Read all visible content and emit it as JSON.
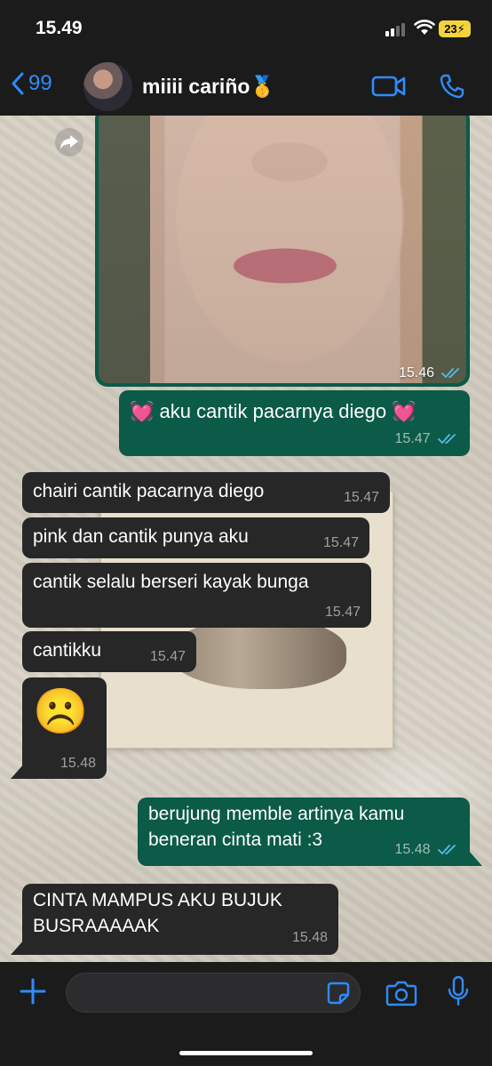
{
  "status_bar": {
    "time": "15.49",
    "battery": "23"
  },
  "header": {
    "back_count": "99",
    "contact_name": "miiii cariño🥇"
  },
  "messages": [
    {
      "id": "photo",
      "direction": "out",
      "type": "image",
      "time": "15.46"
    },
    {
      "id": "m1",
      "direction": "out",
      "text": "💓 aku cantik pacarnya diego 💓",
      "time": "15.47"
    },
    {
      "id": "m2",
      "direction": "in",
      "text": "chairi cantik pacarnya diego",
      "time": "15.47"
    },
    {
      "id": "m3",
      "direction": "in",
      "text": "pink dan cantik punya aku",
      "time": "15.47"
    },
    {
      "id": "m4",
      "direction": "in",
      "text": "cantik selalu berseri kayak bunga",
      "time": "15.47"
    },
    {
      "id": "m5",
      "direction": "in",
      "text": "cantikku",
      "time": "15.47"
    },
    {
      "id": "m6",
      "direction": "in",
      "text": "☹️",
      "time": "15.48"
    },
    {
      "id": "m7",
      "direction": "out",
      "text": "berujung memble artinya kamu beneran cinta mati :3",
      "time": "15.48"
    },
    {
      "id": "m8",
      "direction": "in",
      "text": "CINTA MAMPUS AKU BUJUK BUSRAAAAAK",
      "time": "15.48"
    }
  ],
  "composer": {
    "placeholder": ""
  },
  "colors": {
    "outgoing": "#0c5a48",
    "incoming": "#272727",
    "accent": "#2f8cff",
    "read_ticks": "#53bdeb"
  },
  "icons": [
    "back-chevron-icon",
    "video-call-icon",
    "phone-call-icon",
    "forward-icon",
    "plus-icon",
    "sticker-icon",
    "camera-icon",
    "microphone-icon",
    "read-ticks-icon"
  ]
}
